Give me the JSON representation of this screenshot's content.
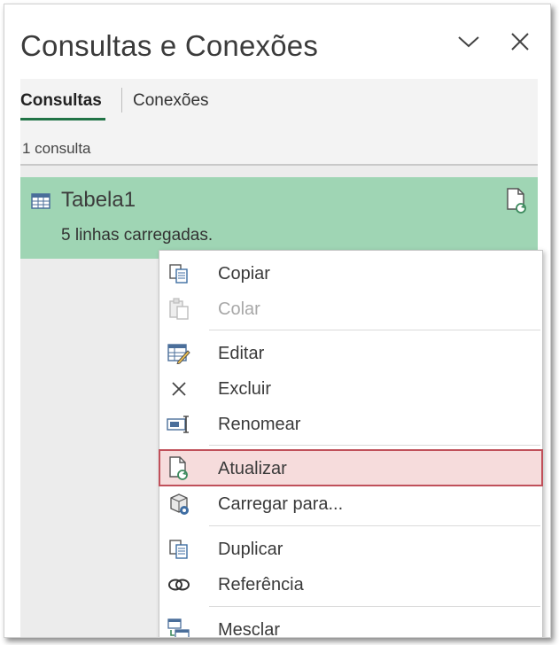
{
  "pane": {
    "title": "Consultas e Conexões"
  },
  "tabs": [
    {
      "label": "Consultas",
      "active": true
    },
    {
      "label": "Conexões",
      "active": false
    }
  ],
  "query_count": "1 consulta",
  "query": {
    "name": "Tabela1",
    "status": "5 linhas carregadas."
  },
  "context_menu": {
    "items": [
      {
        "label": "Copiar",
        "icon": "copy-icon",
        "enabled": true
      },
      {
        "label": "Colar",
        "icon": "paste-icon",
        "enabled": false
      },
      {
        "label": "Editar",
        "icon": "edit-table-icon",
        "enabled": true
      },
      {
        "label": "Excluir",
        "icon": "delete-x-icon",
        "enabled": true
      },
      {
        "label": "Renomear",
        "icon": "rename-icon",
        "enabled": true
      },
      {
        "label": "Atualizar",
        "icon": "refresh-document-icon",
        "enabled": true,
        "highlighted": true
      },
      {
        "label": "Carregar para...",
        "icon": "load-to-icon",
        "enabled": true
      },
      {
        "label": "Duplicar",
        "icon": "duplicate-icon",
        "enabled": true
      },
      {
        "label": "Referência",
        "icon": "reference-link-icon",
        "enabled": true
      },
      {
        "label": "Mesclar",
        "icon": "merge-icon",
        "enabled": true
      }
    ]
  },
  "colors": {
    "accent": "#217346",
    "selected_item_bg": "#9fd5b4",
    "highlight_border": "#c0505a",
    "highlight_bg": "#f6dcdc"
  }
}
